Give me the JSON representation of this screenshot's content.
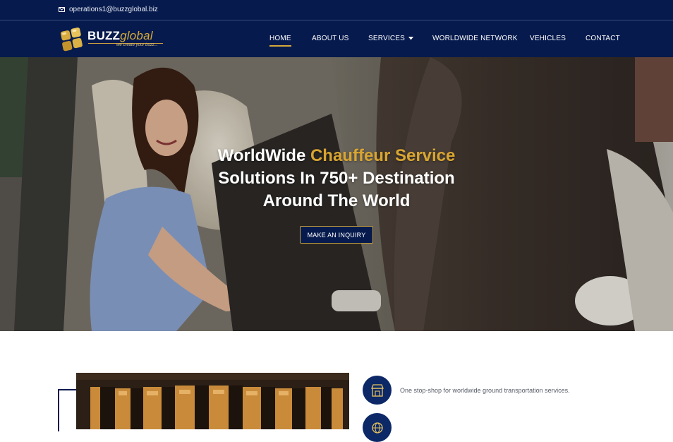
{
  "topbar": {
    "email": "operations1@buzzglobal.biz",
    "email_icon": "envelope-icon"
  },
  "logo": {
    "brand_main": "BUZZ",
    "brand_accent": "global",
    "tagline": "we create your buzz..."
  },
  "nav": {
    "items": [
      {
        "label": "HOME",
        "active": true
      },
      {
        "label": "ABOUT US"
      },
      {
        "label": "SERVICES",
        "has_dropdown": true
      },
      {
        "label": "WORLDWIDE NETWORK"
      },
      {
        "label": "VEHICLES"
      },
      {
        "label": "CONTACT"
      }
    ]
  },
  "hero": {
    "line1_white": "WorldWide ",
    "line1_gold": "Chauffeur Service",
    "line2": "Solutions In 750+ Destination",
    "line3": "Around The World",
    "cta_label": "MAKE AN INQUIRY"
  },
  "features": [
    {
      "icon": "shop-icon",
      "text": "One stop-shop for worldwide ground transportation services."
    },
    {
      "icon": "globe-icon",
      "text": ""
    }
  ],
  "colors": {
    "navy": "#061a4d",
    "gold": "#d6a93a"
  }
}
